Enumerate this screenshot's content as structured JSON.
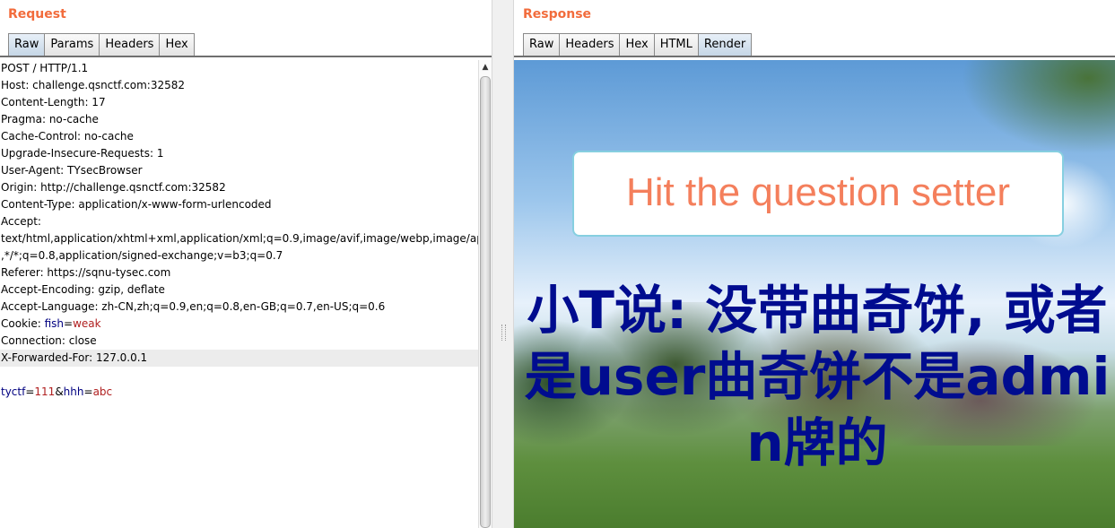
{
  "request": {
    "title": "Request",
    "tabs": [
      "Raw",
      "Params",
      "Headers",
      "Hex"
    ],
    "lines": [
      "POST / HTTP/1.1",
      "Host: challenge.qsnctf.com:32582",
      "Content-Length: 17",
      "Pragma: no-cache",
      "Cache-Control: no-cache",
      "Upgrade-Insecure-Requests: 1",
      "User-Agent: TYsecBrowser",
      "Origin: http://challenge.qsnctf.com:32582",
      "Content-Type: application/x-www-form-urlencoded",
      "Accept:",
      "text/html,application/xhtml+xml,application/xml;q=0.9,image/avif,image/webp,image/apng",
      ",*/*;q=0.8,application/signed-exchange;v=b3;q=0.7",
      "Referer: https://sqnu-tysec.com",
      "Accept-Encoding: gzip, deflate",
      "Accept-Language: zh-CN,zh;q=0.9,en;q=0.8,en-GB;q=0.7,en-US;q=0.6"
    ],
    "cookie": {
      "prefix": "Cookie: ",
      "name": "fish",
      "eq": "=",
      "value": "weak"
    },
    "lines_after": [
      "Connection: close",
      "X-Forwarded-For: 127.0.0.1"
    ],
    "body": {
      "p1": "tyctf",
      "eq1": "=",
      "v1": "111",
      "amp": "&",
      "p2": "hhh",
      "eq2": "=",
      "v2": "abc"
    }
  },
  "response": {
    "title": "Response",
    "tabs": [
      "Raw",
      "Headers",
      "Hex",
      "HTML",
      "Render"
    ],
    "banner_text": "Hit the question setter",
    "message": "小T说: 没带曲奇饼, 或者是user曲奇饼不是admin牌的"
  },
  "colors": {
    "title": "#f26c3c",
    "cookie_name": "#000080",
    "cookie_value": "#b02020",
    "banner_text": "#f47f5c",
    "banner_border": "#86cfe0",
    "message": "#000c8f"
  },
  "icons": {
    "scroll_up": "triangle-up"
  }
}
